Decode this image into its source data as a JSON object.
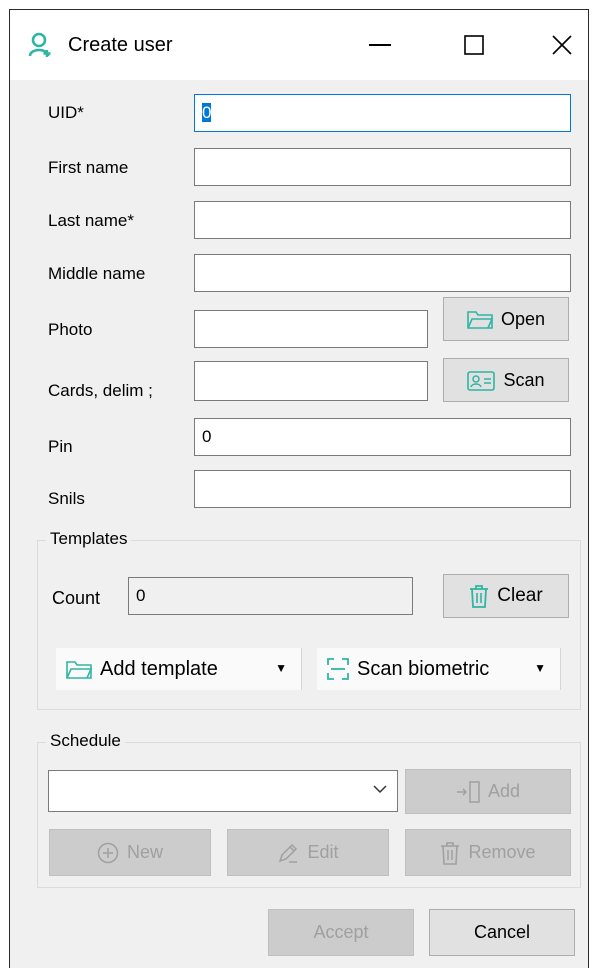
{
  "window": {
    "title": "Create user",
    "icon": "user-add-icon"
  },
  "form": {
    "uid_label": "UID*",
    "uid_value": "0",
    "first_name_label": "First name",
    "first_name_value": "",
    "last_name_label": "Last name*",
    "last_name_value": "",
    "middle_name_label": "Middle name",
    "middle_name_value": "",
    "photo_label": "Photo",
    "photo_value": "",
    "open_label": "Open",
    "cards_label": "Cards, delim ;",
    "cards_value": "",
    "scan_label": "Scan",
    "pin_label": "Pin",
    "pin_value": "0",
    "snils_label": "Snils",
    "snils_value": ""
  },
  "templates": {
    "title": "Templates",
    "count_label": "Count",
    "count_value": "0",
    "clear_label": "Clear",
    "add_template_label": "Add template",
    "scan_biometric_label": "Scan biometric"
  },
  "schedule": {
    "title": "Schedule",
    "selected": "",
    "add_label": "Add",
    "new_label": "New",
    "edit_label": "Edit",
    "remove_label": "Remove"
  },
  "footer": {
    "accept_label": "Accept",
    "cancel_label": "Cancel"
  },
  "colors": {
    "accent": "#0078d7",
    "icon_teal": "#2fb5a3",
    "window_bg": "#f0f0f0"
  }
}
